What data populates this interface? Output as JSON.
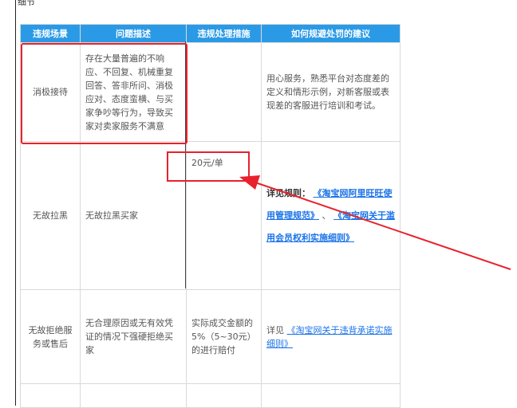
{
  "top_fragment": "细节",
  "table": {
    "headers": [
      "违规场景",
      "问题描述",
      "违规处理措施",
      "如何规避处罚的建议"
    ],
    "row1": {
      "scene": "消极接待",
      "description": "存在大量普遍的不响应、不回复、机械重复回答、答非所问、消极应对、态度蛮横、与买家争吵等行为，导致买家对卖家服务不满意",
      "advice": "用心服务，熟悉平台对态度差的定义和情形示例，对新客服或表现差的客服进行培训和考试。"
    },
    "row2": {
      "scene": "无故拉黑",
      "description": "无故拉黑买家",
      "measure": "20元/单",
      "advice_prefix": "详见规则：",
      "link1": "《淘宝网阿里旺旺使用管理规范》",
      "separator": "、",
      "link2": "《淘宝网关于滥用会员权利实施细则》"
    },
    "row3": {
      "scene": "无故拒绝服务或售后",
      "description": "无合理原因或无有效凭证的情况下强硬拒绝买家",
      "measure": "实际成交金额的5%（5~30元）的进行赔付",
      "advice_prefix": "详见",
      "link": "《淘宝网关于违背承诺实施细则》"
    }
  },
  "annotation": {
    "color": "#e8212c"
  }
}
